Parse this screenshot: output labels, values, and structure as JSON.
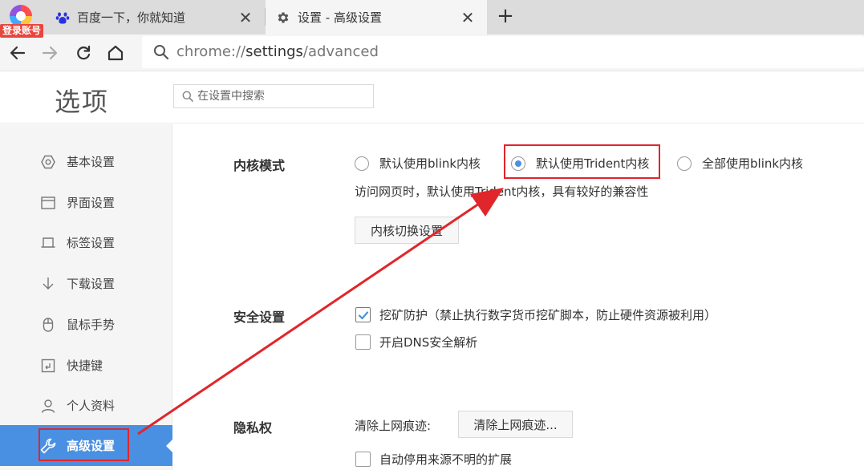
{
  "app": {
    "login_badge": "登录账号"
  },
  "tabs": [
    {
      "title": "百度一下，你就知道",
      "close": "✕"
    },
    {
      "title": "设置 - 高级设置",
      "close": "✕"
    }
  ],
  "new_tab": "+",
  "address": {
    "scheme": "chrome://",
    "host": "settings",
    "path": "/advanced"
  },
  "header": {
    "title": "选项",
    "search_placeholder": "在设置中搜索"
  },
  "sidebar": {
    "items": [
      {
        "label": "基本设置",
        "icon": "hexagon-icon"
      },
      {
        "label": "界面设置",
        "icon": "window-icon"
      },
      {
        "label": "标签设置",
        "icon": "tab-icon"
      },
      {
        "label": "下载设置",
        "icon": "download-icon"
      },
      {
        "label": "鼠标手势",
        "icon": "mouse-icon"
      },
      {
        "label": "快捷键",
        "icon": "shortcut-icon"
      },
      {
        "label": "个人资料",
        "icon": "person-icon"
      },
      {
        "label": "高级设置",
        "icon": "wrench-icon",
        "active": true
      }
    ]
  },
  "kernel": {
    "label": "内核模式",
    "options": [
      {
        "label": "默认使用blink内核",
        "selected": false
      },
      {
        "label": "默认使用Trident内核",
        "selected": true
      },
      {
        "label": "全部使用blink内核",
        "selected": false
      }
    ],
    "description": "访问网页时，默认使用Trident内核，具有较好的兼容性",
    "switch_button": "内核切换设置"
  },
  "security": {
    "label": "安全设置",
    "mining_protection": {
      "label": "挖矿防护（禁止执行数字货币挖矿脚本，防止硬件资源被利用）",
      "checked": true
    },
    "dns": {
      "label": "开启DNS安全解析",
      "checked": false
    }
  },
  "privacy": {
    "label": "隐私权",
    "clear_label": "清除上网痕迹:",
    "clear_button": "清除上网痕迹...",
    "auto_disable": {
      "label": "自动停用来源不明的扩展",
      "checked": false
    }
  },
  "colors": {
    "accent": "#4a90e2",
    "highlight": "#e0262b",
    "checkbox": "#4a90e2"
  }
}
